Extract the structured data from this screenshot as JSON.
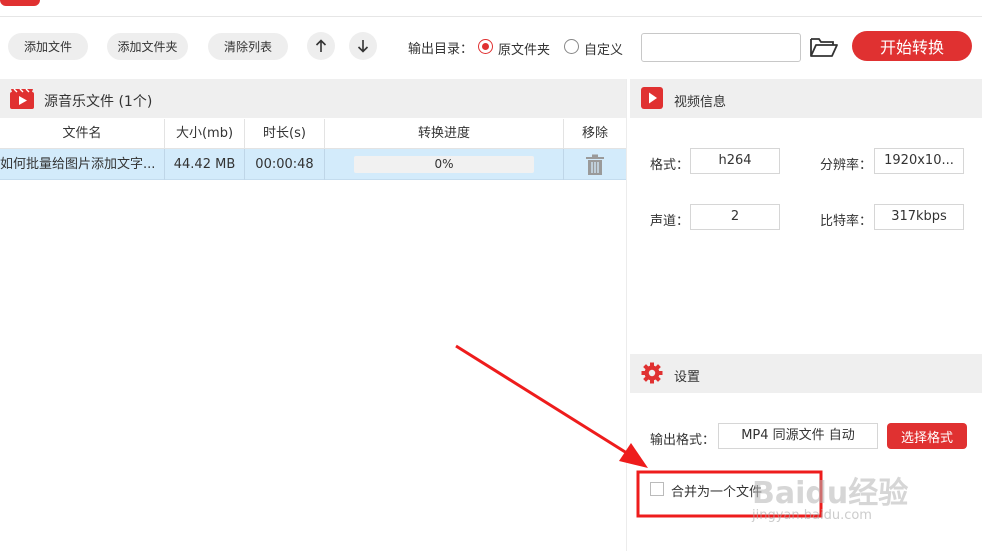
{
  "toolbar": {
    "add_file": "添加文件",
    "add_folder": "添加文件夹",
    "clear_list": "清除列表",
    "output_dir_label": "输出目录：",
    "radio_source": "原文件夹",
    "radio_custom": "自定义",
    "path_value": "",
    "start_button": "开始转换"
  },
  "file_list": {
    "header_title": "源音乐文件 (1个)",
    "columns": [
      "文件名",
      "大小(mb)",
      "时长(s)",
      "转换进度",
      "移除"
    ],
    "rows": [
      {
        "name": "如何批量给图片添加文字...",
        "size": "44.42 MB",
        "duration": "00:00:48",
        "progress": "0%"
      }
    ]
  },
  "video_info": {
    "title": "视频信息",
    "format_label": "格式：",
    "format_value": "h264",
    "resolution_label": "分辨率：",
    "resolution_value": "1920x10...",
    "channel_label": "声道：",
    "channel_value": "2",
    "bitrate_label": "比特率：",
    "bitrate_value": "317kbps"
  },
  "settings": {
    "title": "设置",
    "output_format_label": "输出格式：",
    "output_format_value": "MP4 同源文件 自动",
    "choose_format_button": "选择格式",
    "merge_label": "合并为一个文件"
  },
  "watermark": {
    "text": "Baidu经验",
    "sub": "jingyan.baidu.com"
  },
  "colors": {
    "accent": "#e03131",
    "selected_row": "#d3ebfb",
    "panel_header": "#efefef"
  },
  "icons": [
    "app-logo-icon",
    "arrow-up-icon",
    "arrow-down-icon",
    "folder-open-icon",
    "music-file-icon",
    "trash-icon",
    "video-play-icon",
    "gear-icon"
  ]
}
